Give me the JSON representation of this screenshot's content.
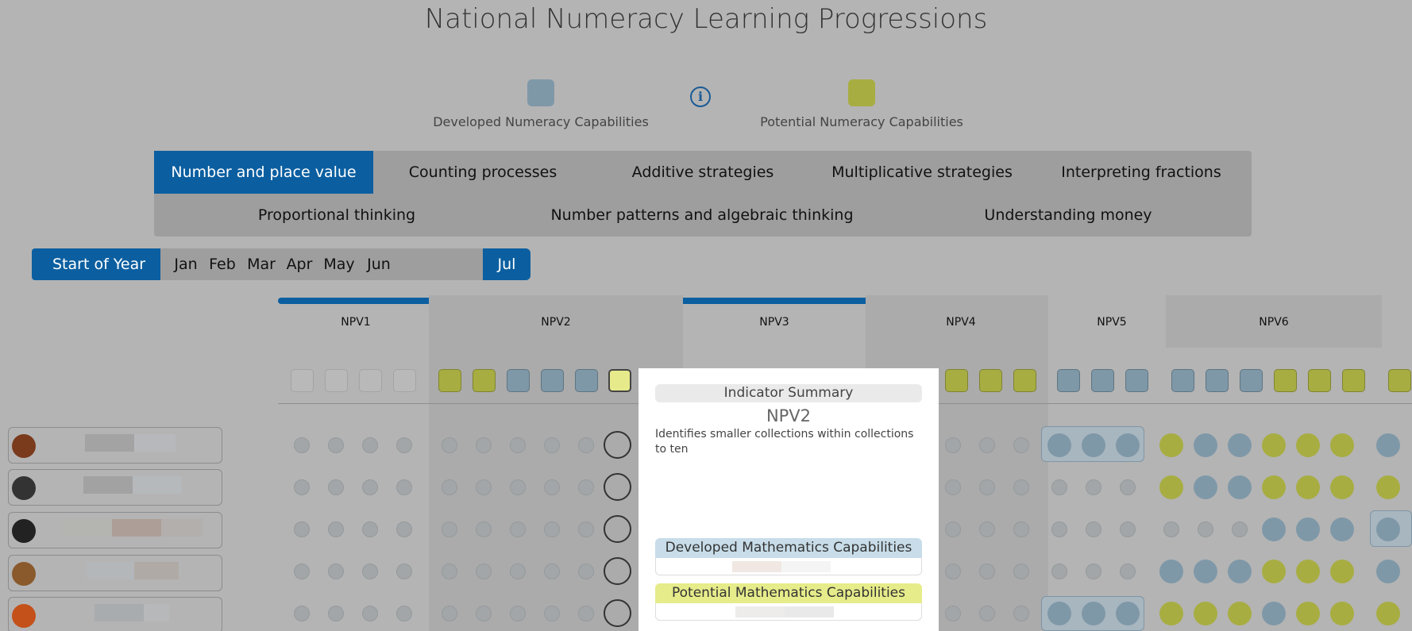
{
  "title": "National Numeracy Learning Progressions",
  "legend": {
    "developed": {
      "label": "Developed Numeracy Capabilities",
      "color": "#7f98a8"
    },
    "potential": {
      "label": "Potential Numeracy Capabilities",
      "color": "#a8ad42"
    },
    "info_icon": "info-icon"
  },
  "tabs": [
    {
      "label": "Number and place value",
      "active": true
    },
    {
      "label": "Counting processes",
      "active": false
    },
    {
      "label": "Additive strategies",
      "active": false
    },
    {
      "label": "Multiplicative strategies",
      "active": false
    },
    {
      "label": "Interpreting fractions",
      "active": false
    },
    {
      "label": "Proportional thinking",
      "active": false
    },
    {
      "label": "Number patterns and algebraic thinking",
      "active": false
    },
    {
      "label": "Understanding money",
      "active": false
    }
  ],
  "timeline": {
    "start_label": "Start of Year",
    "months": [
      "Jan",
      "Feb",
      "Mar",
      "Apr",
      "May",
      "Jun",
      "Jul"
    ],
    "active_month": "Jul"
  },
  "columns": [
    "NPV1",
    "NPV2",
    "NPV3",
    "NPV4",
    "NPV5",
    "NPV6"
  ],
  "students": [
    {
      "avatar": "monkey-avatar"
    },
    {
      "avatar": "bear-avatar"
    },
    {
      "avatar": "penguin-avatar"
    },
    {
      "avatar": "dog-avatar"
    },
    {
      "avatar": "fox-avatar"
    }
  ],
  "popup": {
    "heading": "Indicator Summary",
    "code": "NPV2",
    "description": "Identifies smaller collections within collections to ten",
    "developed_heading": "Developed Mathematics Capabilities",
    "potential_heading": "Potential Mathematics Capabilities"
  }
}
